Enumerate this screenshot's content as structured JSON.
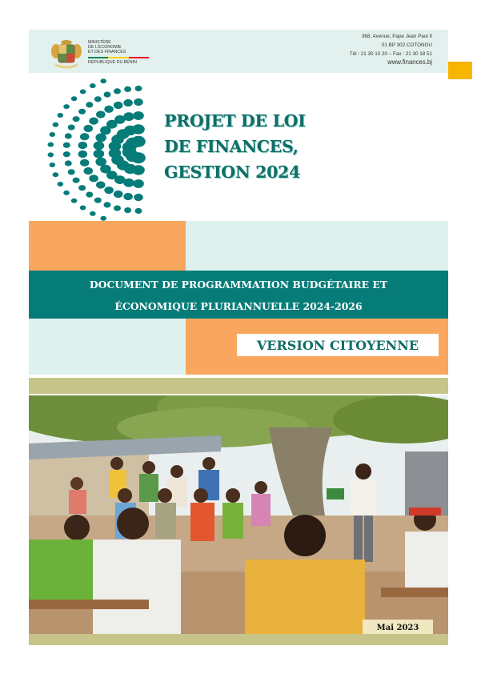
{
  "header": {
    "ministry_lines": [
      "MINISTÈRE",
      "DE L'ÉCONOMIE",
      "ET DES FINANCES"
    ],
    "country": "RÉPUBLIQUE DU BÉNIN",
    "address_lines": [
      "368, Avenue, Pape Jean Paul II",
      "01 BP 302 COTONOU",
      "Tél : 21 30 10 20 – Fax : 21 30 18 51"
    ],
    "website": "www.finances.bj",
    "flag_colors": [
      "#008751",
      "#fcd116",
      "#e8112d"
    ]
  },
  "title_lines": [
    "PROJET DE LOI",
    "DE FINANCES,",
    "GESTION 2024"
  ],
  "subtitle_lines": [
    "DOCUMENT DE PROGRAMMATION BUDGÉTAIRE ET",
    "ÉCONOMIQUE PLURIANNUELLE 2024-2026"
  ],
  "version_label": "VERSION CITOYENNE",
  "date_label": "Mai  2023",
  "colors": {
    "teal": "#067c79",
    "title_teal": "#0f6e68",
    "orange": "#f9a75e",
    "light_teal": "#dff1ef",
    "khaki": "#c7c489",
    "yellow": "#f7b500"
  },
  "illustration": {
    "icon": "community-meeting-illustration"
  }
}
